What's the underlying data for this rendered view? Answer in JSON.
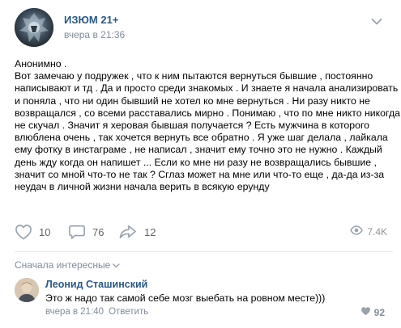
{
  "post": {
    "group_name": "ИЗЮМ 21+",
    "time": "вчера в 21:36",
    "text_lines": [
      "Анонимно .",
      "Вот замечаю у подружек , что к ним пытаются вернуться бывшие , постоянно",
      "написывают и тд . Да и просто среди знакомых . И знаете я начала анализировать",
      "и поняла , что ни один бывший не хотел ко мне вернуться . Ни разу никто не",
      "возвращался , со всеми расставались мирно . Понимаю , что по мне никто никогда",
      "не скучал . Значит я херовая бывшая получается ? Есть мужчина в которого",
      "влюблена очень , так хочется вернуть все обратно . Я уже шаг делала , лайкала",
      "ему фотку в инстаграме , не написал , значит ему точно это не нужно . Каждый",
      "день жду когда он напишет ... Если ко мне ни разу не возвращались бывшие ,",
      "значит со мной что-то не так ? Сглаз может на мне или что-то еще , да-да из-за",
      "неудач в личной жизни начала верить в всякую ерунду"
    ]
  },
  "actions": {
    "likes": "10",
    "comments": "76",
    "shares": "12",
    "views": "7.4K"
  },
  "comments_section": {
    "sort_label": "Сначала интересные"
  },
  "comment": {
    "author": "Леонид Сташинский",
    "text": "Это ж надо так самой себе мозг выебать на ровном месте)))",
    "time": "вчера в 21:40",
    "reply_label": "Ответить",
    "likes": "92"
  },
  "icons": {
    "like": "heart-icon",
    "comment": "comment-icon",
    "share": "share-arrow-icon",
    "views": "eye-icon",
    "more": "chevron-down-icon",
    "sort": "chevron-down-icon"
  },
  "colors": {
    "link": "#2a5885",
    "secondary": "#818c99",
    "icon": "#99a2ad"
  }
}
